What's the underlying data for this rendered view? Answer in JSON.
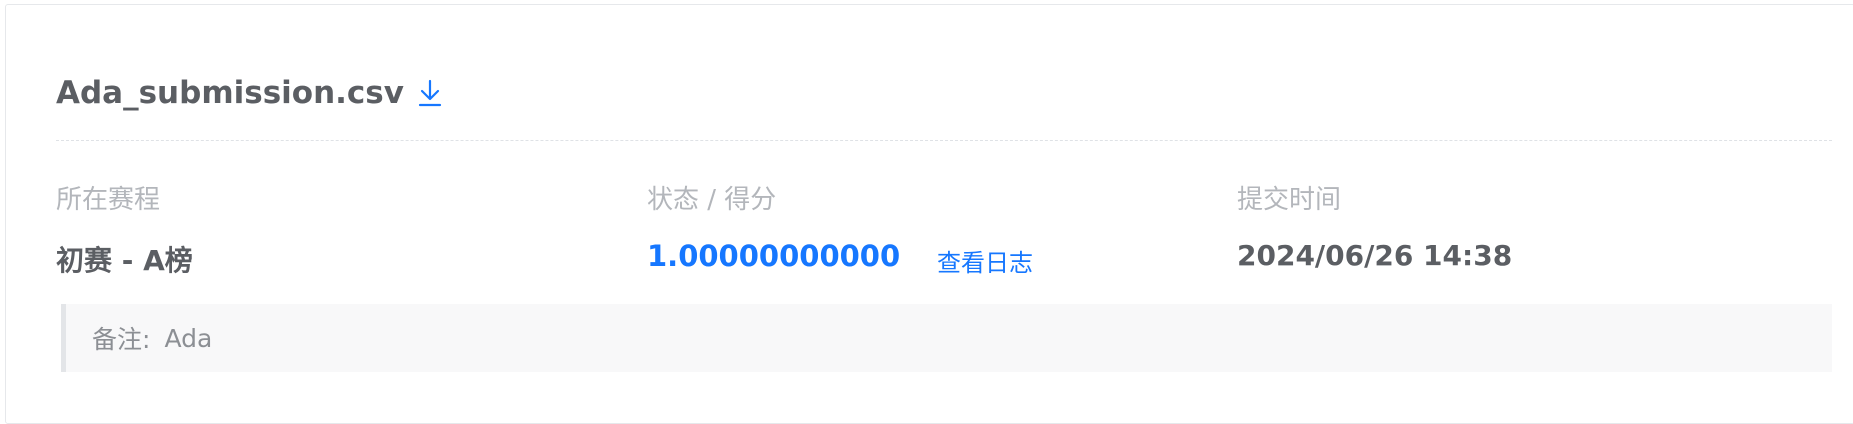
{
  "submission": {
    "file_name": "Ada_submission.csv",
    "download_icon": "download-icon"
  },
  "columns": {
    "round_label": "所在赛程",
    "status_label": "状态 / 得分",
    "time_label": "提交时间"
  },
  "values": {
    "round": "初赛 - A榜",
    "score": "1.00000000000",
    "view_log": "查看日志",
    "submit_time": "2024/06/26 14:38"
  },
  "remark": {
    "label": "备注:",
    "text": "Ada"
  },
  "colors": {
    "accent": "#1677ff",
    "text_primary": "#5b5e63",
    "text_muted": "#b3b6bb"
  }
}
